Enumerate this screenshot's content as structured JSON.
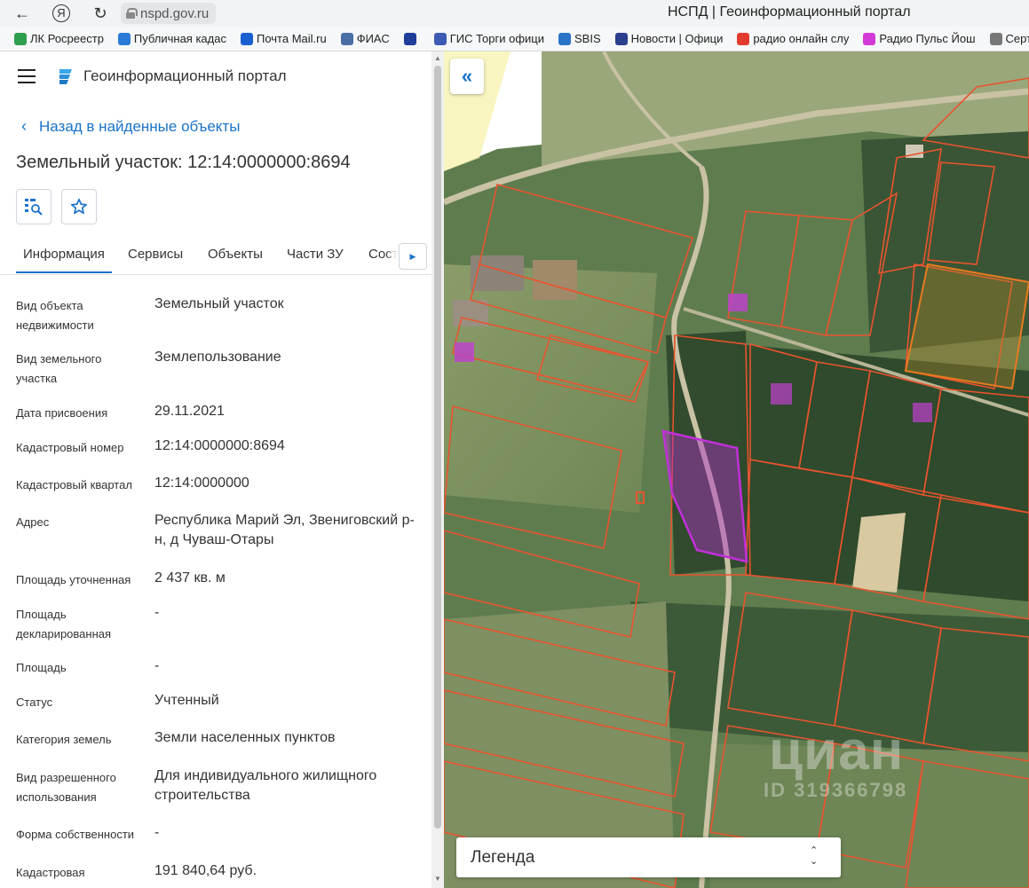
{
  "browser": {
    "url": "nspd.gov.ru",
    "tab_title": "НСПД | Геоинформационный портал",
    "bookmarks": [
      {
        "label": "ЛК Росреестр",
        "color": "#2e9e4f"
      },
      {
        "label": "Публичная кадас",
        "color": "#2b7bd6"
      },
      {
        "label": "Почта Mail.ru",
        "color": "#1a5fd0"
      },
      {
        "label": "ФИАС",
        "color": "#4a6fa5"
      },
      {
        "label": "",
        "color": "#1e3e9a"
      },
      {
        "label": "ГИС Торги офици",
        "color": "#3d5ab5"
      },
      {
        "label": "SBIS",
        "color": "#2a74c8"
      },
      {
        "label": "Новости | Офици",
        "color": "#2b3f8e"
      },
      {
        "label": "радио онлайн слу",
        "color": "#e23b2e"
      },
      {
        "label": "Радио Пульс Йош",
        "color": "#d43ad6"
      },
      {
        "label": "Серти",
        "color": "#777777"
      }
    ]
  },
  "app": {
    "title": "Геоинформационный портал",
    "back_label": "Назад в найденные объекты",
    "object_title": "Земельный участок: 12:14:0000000:8694"
  },
  "tabs": [
    "Информация",
    "Сервисы",
    "Объекты",
    "Части ЗУ",
    "Соста"
  ],
  "fields": [
    {
      "label": "Вид объекта недвижимости",
      "value": "Земельный участок"
    },
    {
      "label": "Вид земельного участка",
      "value": "Землепользование"
    },
    {
      "label": "Дата присвоения",
      "value": "29.11.2021"
    },
    {
      "label": "Кадастровый номер",
      "value": "12:14:0000000:8694"
    },
    {
      "label": "Кадастровый квартал",
      "value": "12:14:0000000"
    },
    {
      "label": "Адрес",
      "value": "Республика Марий Эл, Звениговский р-н, д Чуваш-Отары"
    },
    {
      "label": "Площадь уточненная",
      "value": "2 437 кв. м"
    },
    {
      "label": "Площадь декларированная",
      "value": "-"
    },
    {
      "label": "Площадь",
      "value": "-"
    },
    {
      "label": "Статус",
      "value": "Учтенный"
    },
    {
      "label": "Категория земель",
      "value": "Земли населенных пунктов"
    },
    {
      "label": "Вид разрешенного использования",
      "value": "Для индивидуального жилищного строительства"
    },
    {
      "label": "Форма собственности",
      "value": "-"
    },
    {
      "label": "Кадастровая",
      "value": "191 840,64 руб."
    }
  ],
  "map": {
    "legend_label": "Легенда",
    "watermark_brand": "циан",
    "watermark_id": "ID 319366798",
    "colors": {
      "parcel_border": "#e8542f",
      "selected_parcel": "#b030c8",
      "building": "#c040d0"
    }
  }
}
